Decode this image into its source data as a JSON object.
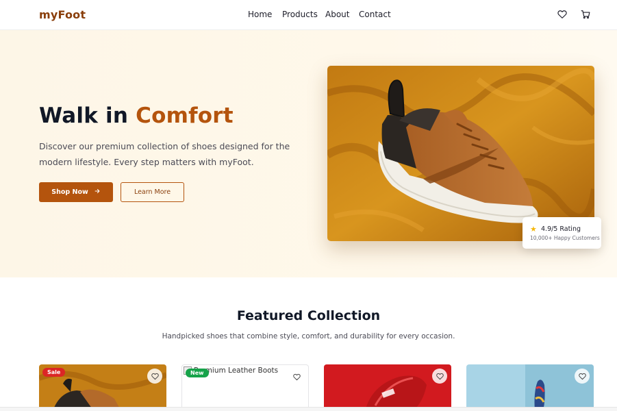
{
  "brand": {
    "logo": "myFoot"
  },
  "nav": {
    "links": [
      "Home",
      "Products",
      "About",
      "Contact"
    ],
    "icons": [
      "heart-icon",
      "cart-icon"
    ]
  },
  "hero": {
    "title_plain": "Walk in ",
    "title_accent": "Comfort",
    "description": "Discover our premium collection of shoes designed for the modern lifestyle. Every step matters with myFoot.",
    "primary_button": "Shop Now",
    "secondary_button": "Learn More",
    "rating": {
      "value": "4.9/5 Rating",
      "subtext": "10,000+ Happy Customers"
    }
  },
  "featured": {
    "title": "Featured Collection",
    "subtitle": "Handpicked shoes that combine style, comfort, and durability for every occasion.",
    "products": [
      {
        "badge": "Sale",
        "image_alt": ""
      },
      {
        "badge": "New",
        "image_alt": "Premium Leather Boots"
      },
      {
        "badge": "",
        "image_alt": ""
      },
      {
        "badge": "",
        "image_alt": ""
      }
    ]
  },
  "colors": {
    "brand": "#b4540d",
    "logo": "#8a3f0c",
    "hero_bg": "#fdf6e7",
    "sale_badge": "#dc2626",
    "new_badge": "#16a34a",
    "star": "#f5b70a"
  }
}
